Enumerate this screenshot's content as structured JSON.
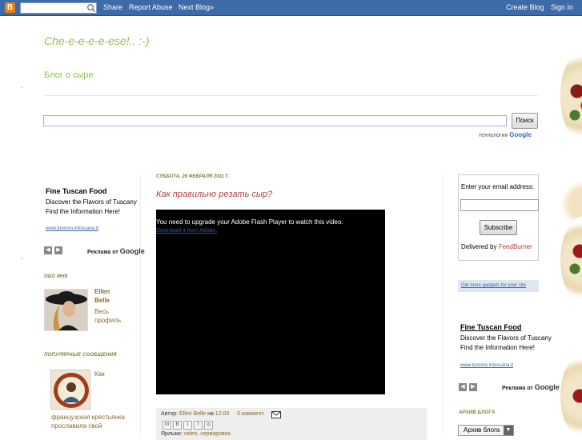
{
  "navbar": {
    "share": "Share",
    "report_abuse": "Report Abuse",
    "next_blog": "Next Blog»",
    "create_blog": "Create Blog",
    "sign_in": "Sign In",
    "logo_letter": "B"
  },
  "header": {
    "title": "Che-e-e-e-e-ese!.. :-)",
    "description": "Блог о сыре"
  },
  "search": {
    "button": "Поиск",
    "powered_by": "технология",
    "google": "Google"
  },
  "left_sidebar": {
    "ad": {
      "title": "Fine Tuscan Food",
      "text": "Discover the Flavors of Tuscany Find the Information Here!",
      "url": "www.turismo.intoscana.it",
      "ads_by": "Реклама от",
      "google": "Google"
    },
    "about": {
      "heading": "ОБО МНЕ",
      "name": "Ellen Belle",
      "profile_link": "Весь профиль"
    },
    "popular": {
      "heading": "ПОПУЛЯРНЫЕ СООБЩЕНИЯ",
      "item_title": "Как",
      "item_excerpt": "французская крестьянка прославила свой"
    }
  },
  "post": {
    "date": "СУББОТА, 26 ФЕВРАЛЯ 2011 Г.",
    "title": "Как правильно резать сыр?",
    "video_message": "You need to upgrade your Adobe Flash Player to watch this video.",
    "video_link": "Download it from Adobe.",
    "author_label": "Автор:",
    "author": "Ellen Belle",
    "at": "на",
    "time": "12:00",
    "comments": "0 коммент.",
    "labels_label": "Ярлыки:",
    "labels": "video, сервировка"
  },
  "right_sidebar": {
    "email": {
      "label": "Enter your email address:",
      "subscribe": "Subscribe",
      "delivered_by": "Delivered by",
      "feedburner": "FeedBurner"
    },
    "gadgets_link": "Get more gadgets for your site",
    "ad": {
      "title": "Fine Tuscan Food",
      "text": "Discover the Flavors of Tuscany Find the Information Here!",
      "url": "www.turismo.intoscana.it",
      "ads_by": "Реклама от",
      "google": "Google"
    },
    "archive": {
      "heading": "АРХИВ БЛОГА",
      "select_value": "Архив блога"
    }
  },
  "colors": {
    "navbar": "#3d6aa8",
    "title_green": "#8bc53f",
    "post_title_red": "#b43d3d",
    "section_heading": "#6b8a3a",
    "link_brown": "#8a6a2a"
  }
}
